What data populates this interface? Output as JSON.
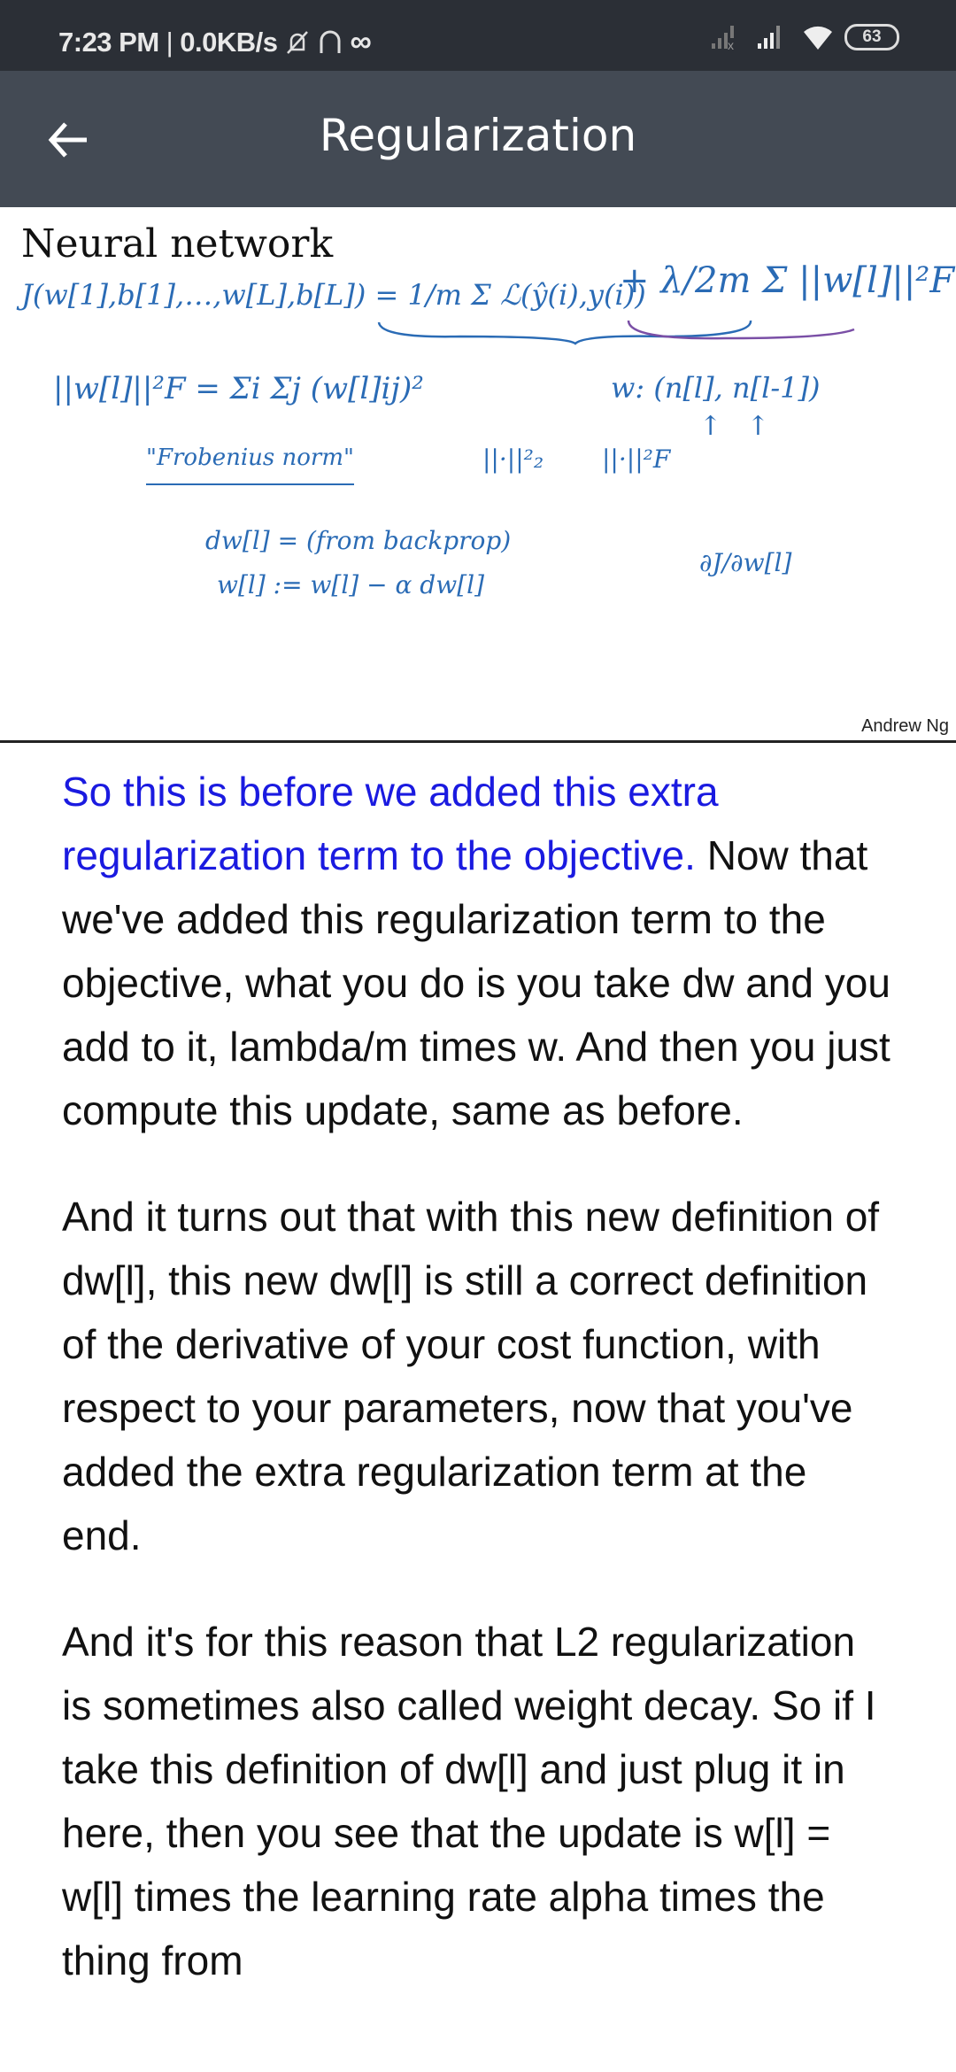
{
  "status_bar": {
    "time": "7:23 PM",
    "separator": "|",
    "net_speed": "0.0KB/s",
    "battery": "63",
    "icons": [
      "mute-bell-icon",
      "headset-icon",
      "infinity-icon",
      "signal-none-icon",
      "signal-icon",
      "wifi-icon",
      "battery-icon"
    ]
  },
  "app_bar": {
    "title": "Regularization",
    "back_icon": "arrow-left-icon"
  },
  "slide": {
    "title": "Neural network",
    "eq_cost": "J(w[1],b[1],…,w[L],b[L]) = 1/m Σ ℒ(ŷ(i),y(i))",
    "eq_reg": "+ λ/2m Σ ||w[l]||²F",
    "eq_frob": "||w[l]||²F = Σi Σj (w[l]ij)²",
    "eq_shape": "w: (n[l], n[l-1])",
    "frobenius": "\"Frobenius norm\"",
    "norm2": "||·||²₂",
    "normF": "||·||²F",
    "dw": "dw[l] = (from backprop)",
    "update": "w[l] := w[l] − α dw[l]",
    "partial": "∂J/∂w[l]",
    "credit": "Andrew Ng"
  },
  "transcript": {
    "p1_highlight": "So this is before we added this extra regularization term to the objective.",
    "p1_rest": " Now that we've added this regularization term to the objective, what you do is you take dw and you add to it, lambda/m times w. And then you just compute this update, same as before.",
    "p2": "And it turns out that with this new definition of dw[l], this new dw[l] is still a correct definition of the derivative of your cost function, with respect to your parameters, now that you've added the extra regularization term at the end.",
    "p3": "And it's for this reason that L2 regularization is sometimes also called weight decay. So if I take this definition of dw[l] and just plug it in here, then you see that the update is w[l] = w[l] times the learning rate alpha times the thing from"
  },
  "colors": {
    "highlight": "#1a1ae0",
    "ink": "#2a6bb5",
    "appbar": "#434a54",
    "statusbar": "#2b2f36"
  }
}
